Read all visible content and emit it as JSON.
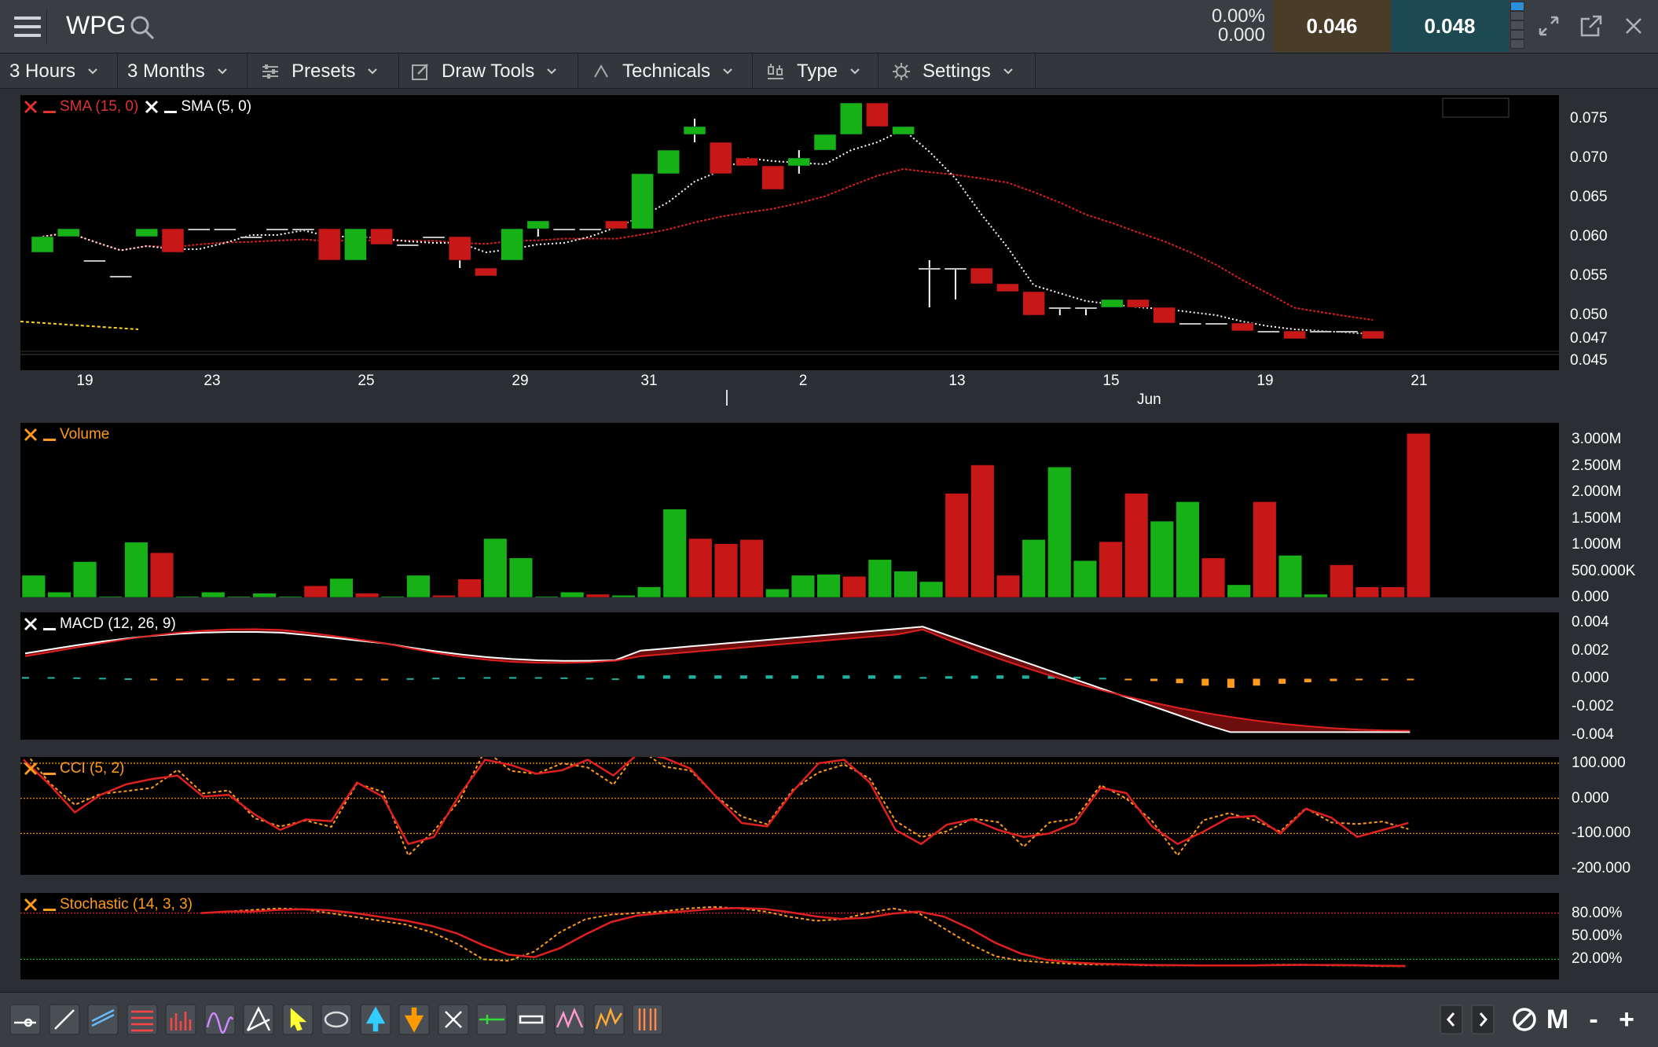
{
  "header": {
    "symbol": "WPG",
    "pct_change": "0.00%",
    "abs_change": "0.000",
    "bid": "0.046",
    "ask": "0.048"
  },
  "toolbar": {
    "interval": "3 Hours",
    "range": "3 Months",
    "presets": "Presets",
    "draw_tools": "Draw Tools",
    "technicals": "Technicals",
    "type": "Type",
    "settings": "Settings"
  },
  "price_panel": {
    "legend_sma15": "SMA (15, 0)",
    "legend_sma5": "SMA (5, 0)",
    "y_ticks": [
      "0.075",
      "0.070",
      "0.065",
      "0.060",
      "0.055",
      "0.050",
      "0.047",
      "0.045"
    ],
    "x_ticks": [
      "19",
      "23",
      "25",
      "29",
      "31",
      "2",
      "13",
      "15",
      "19",
      "21"
    ],
    "month_label": "Jun"
  },
  "volume_panel": {
    "legend": "Volume",
    "y_ticks": [
      "3.000M",
      "2.500M",
      "2.000M",
      "1.500M",
      "1.000M",
      "500.000K",
      "0.000"
    ]
  },
  "macd_panel": {
    "legend": "MACD (12, 26, 9)",
    "y_ticks": [
      "0.004",
      "0.002",
      "0.000",
      "-0.002",
      "-0.004"
    ]
  },
  "cci_panel": {
    "legend": "CCI (5, 2)",
    "y_ticks": [
      "100.000",
      "0.000",
      "-100.000",
      "-200.000"
    ]
  },
  "stoch_panel": {
    "legend": "Stochastic (14, 3, 3)",
    "y_ticks": [
      "80.00%",
      "50.00%",
      "20.00%"
    ]
  },
  "bottom_bar": {
    "mode_label": "M",
    "zoom_out": "-",
    "zoom_in": "+"
  },
  "chart_data": [
    {
      "type": "candlestick",
      "title": "WPG",
      "x": [
        "19",
        "",
        "",
        "",
        "23",
        "",
        "",
        "",
        "",
        "",
        "",
        "25",
        "",
        "",
        "",
        "",
        "",
        "29",
        "",
        "",
        "",
        "",
        "31",
        "",
        "",
        "",
        "",
        "",
        "2",
        "",
        "",
        "",
        "",
        "",
        "",
        "13",
        "",
        "",
        "",
        "",
        "",
        "",
        "15",
        "",
        "",
        "",
        "",
        "",
        "19",
        "",
        "",
        "",
        "",
        "",
        "21"
      ],
      "series": [
        {
          "name": "Price",
          "values": [
            [
              0.058,
              0.06,
              0.058,
              0.06
            ],
            [
              0.06,
              0.061,
              0.06,
              0.061
            ],
            [
              0.057,
              0.057,
              0.057,
              0.057
            ],
            [
              0.055,
              0.055,
              0.055,
              0.055
            ],
            [
              0.06,
              0.061,
              0.06,
              0.061
            ],
            [
              0.061,
              0.061,
              0.058,
              0.058
            ],
            [
              0.061,
              0.061,
              0.061,
              0.061
            ],
            [
              0.061,
              0.061,
              0.061,
              0.061
            ],
            [
              0.06,
              0.06,
              0.06,
              0.06
            ],
            [
              0.061,
              0.061,
              0.061,
              0.061
            ],
            [
              0.061,
              0.061,
              0.061,
              0.061
            ],
            [
              0.061,
              0.061,
              0.057,
              0.057
            ],
            [
              0.057,
              0.061,
              0.057,
              0.061
            ],
            [
              0.061,
              0.061,
              0.059,
              0.059
            ],
            [
              0.059,
              0.059,
              0.059,
              0.059
            ],
            [
              0.06,
              0.06,
              0.06,
              0.06
            ],
            [
              0.06,
              0.06,
              0.056,
              0.057
            ],
            [
              0.056,
              0.056,
              0.055,
              0.055
            ],
            [
              0.057,
              0.061,
              0.057,
              0.061
            ],
            [
              0.061,
              0.062,
              0.06,
              0.062
            ],
            [
              0.061,
              0.061,
              0.061,
              0.061
            ],
            [
              0.061,
              0.061,
              0.061,
              0.061
            ],
            [
              0.062,
              0.062,
              0.061,
              0.061
            ],
            [
              0.061,
              0.068,
              0.061,
              0.068
            ],
            [
              0.068,
              0.071,
              0.068,
              0.071
            ],
            [
              0.073,
              0.075,
              0.072,
              0.074
            ],
            [
              0.072,
              0.072,
              0.068,
              0.068
            ],
            [
              0.07,
              0.07,
              0.069,
              0.069
            ],
            [
              0.069,
              0.069,
              0.066,
              0.066
            ],
            [
              0.069,
              0.071,
              0.068,
              0.07
            ],
            [
              0.071,
              0.073,
              0.071,
              0.073
            ],
            [
              0.073,
              0.077,
              0.073,
              0.077
            ],
            [
              0.077,
              0.077,
              0.074,
              0.074
            ],
            [
              0.073,
              0.074,
              0.073,
              0.074
            ],
            [
              0.056,
              0.057,
              0.051,
              0.056
            ],
            [
              0.056,
              0.056,
              0.052,
              0.056
            ],
            [
              0.056,
              0.056,
              0.054,
              0.054
            ],
            [
              0.054,
              0.054,
              0.053,
              0.053
            ],
            [
              0.053,
              0.053,
              0.05,
              0.05
            ],
            [
              0.051,
              0.051,
              0.05,
              0.051
            ],
            [
              0.051,
              0.051,
              0.05,
              0.051
            ],
            [
              0.051,
              0.052,
              0.051,
              0.052
            ],
            [
              0.052,
              0.052,
              0.051,
              0.051
            ],
            [
              0.051,
              0.051,
              0.049,
              0.049
            ],
            [
              0.049,
              0.049,
              0.049,
              0.049
            ],
            [
              0.049,
              0.049,
              0.049,
              0.049
            ],
            [
              0.049,
              0.049,
              0.048,
              0.048
            ],
            [
              0.048,
              0.048,
              0.048,
              0.048
            ],
            [
              0.048,
              0.048,
              0.047,
              0.047
            ],
            [
              0.048,
              0.048,
              0.048,
              0.048
            ],
            [
              0.048,
              0.048,
              0.048,
              0.048
            ],
            [
              0.048,
              0.048,
              0.047,
              0.047
            ]
          ]
        }
      ],
      "ylim": [
        0.045,
        0.078
      ]
    },
    {
      "type": "bar",
      "title": "Volume",
      "values": [
        0.42,
        0.1,
        0.68,
        0.02,
        1.05,
        0.85,
        0.02,
        0.1,
        0.02,
        0.08,
        0.02,
        0.22,
        0.36,
        0.08,
        0.02,
        0.42,
        0.04,
        0.35,
        1.12,
        0.75,
        0.02,
        0.1,
        0.06,
        0.04,
        0.2,
        1.68,
        1.12,
        1.02,
        1.1,
        0.16,
        0.42,
        0.44,
        0.4,
        0.72,
        0.5,
        0.3,
        1.98,
        2.52,
        0.42,
        1.1,
        2.48,
        0.7,
        1.06,
        1.98,
        1.45,
        1.82,
        0.75,
        0.24,
        1.82,
        0.8,
        0.06,
        0.62,
        0.2,
        0.2,
        3.12
      ],
      "ylabel": "",
      "ylim": [
        0,
        3.2
      ]
    },
    {
      "type": "line",
      "title": "MACD (12, 26, 9)",
      "ylim": [
        -0.004,
        0.0045
      ]
    },
    {
      "type": "line",
      "title": "CCI (5, 2)",
      "ylim": [
        -200,
        100
      ]
    },
    {
      "type": "line",
      "title": "Stochastic (14, 3, 3)",
      "ylim": [
        0,
        100
      ]
    }
  ]
}
